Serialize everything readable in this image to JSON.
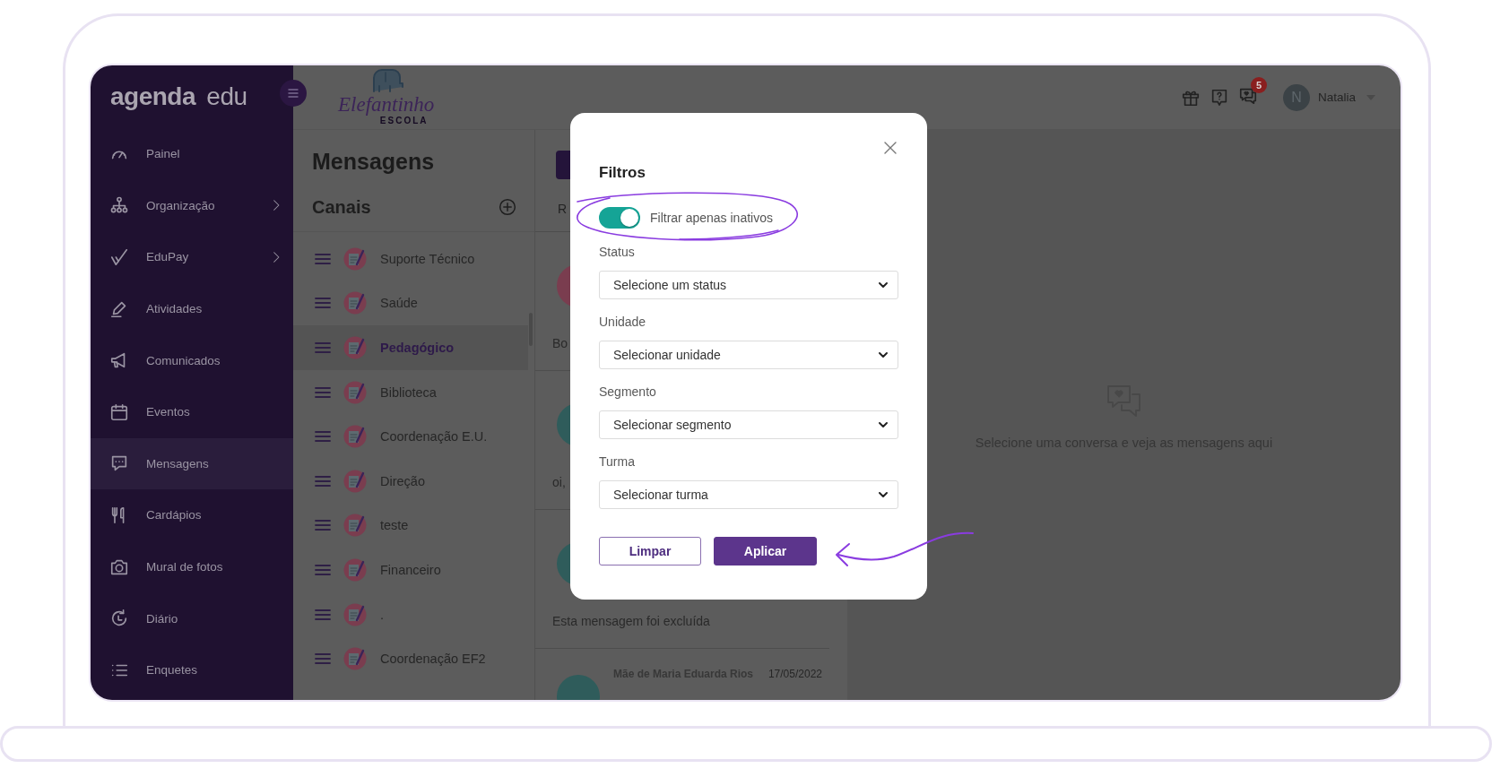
{
  "sidebar": {
    "logo": "**agenda** edu",
    "items": [
      {
        "label": "Painel",
        "selected": false,
        "has_submenu": false
      },
      {
        "label": "Organização",
        "selected": false,
        "has_submenu": true
      },
      {
        "label": "EduPay",
        "selected": false,
        "has_submenu": true
      },
      {
        "label": "Atividades",
        "selected": false,
        "has_submenu": false
      },
      {
        "label": "Comunicados",
        "selected": false,
        "has_submenu": false
      },
      {
        "label": "Eventos",
        "selected": false,
        "has_submenu": false
      },
      {
        "label": "Mensagens",
        "selected": true,
        "has_submenu": false
      },
      {
        "label": "Cardápios",
        "selected": false,
        "has_submenu": false
      },
      {
        "label": "Mural de fotos",
        "selected": false,
        "has_submenu": false
      },
      {
        "label": "Diário",
        "selected": false,
        "has_submenu": false
      },
      {
        "label": "Enquetes",
        "selected": false,
        "has_submenu": false
      }
    ]
  },
  "header": {
    "school_name": "Elefantinho",
    "school_subtitle": "ESCOLA",
    "notification_count": "5",
    "user_initial": "N",
    "user_name": "Natalia"
  },
  "channels_panel": {
    "title": "Mensagens",
    "section_title": "Canais",
    "channels": [
      {
        "name": "Suporte Técnico",
        "selected": false
      },
      {
        "name": "Saúde",
        "selected": false
      },
      {
        "name": "Pedagógico",
        "selected": true
      },
      {
        "name": "Biblioteca",
        "selected": false
      },
      {
        "name": "Coordenação E.U.",
        "selected": false
      },
      {
        "name": "Direção",
        "selected": false
      },
      {
        "name": "teste",
        "selected": false
      },
      {
        "name": "Financeiro",
        "selected": false
      },
      {
        "name": ".",
        "selected": false
      },
      {
        "name": "Coordenação EF2",
        "selected": false
      }
    ]
  },
  "conversations": {
    "tab": "R",
    "items": [
      {
        "kind": "preview",
        "preview": "Bo",
        "color": "#7a3d4f"
      },
      {
        "kind": "preview",
        "preview": "oi,",
        "color": "#2f5c5b"
      },
      {
        "kind": "preview",
        "preview": "Esta mensagem foi excluída",
        "color": "#2f5c5b"
      },
      {
        "kind": "header",
        "sender": "Mãe de Maria Eduarda Rios",
        "date": "17/05/2022",
        "color": "#2f5c5b"
      }
    ]
  },
  "empty_state": {
    "message": "Selecione uma conversa e veja as mensagens aqui"
  },
  "filter_modal": {
    "title": "Filtros",
    "toggle": {
      "label": "Filtrar apenas inativos",
      "on": true
    },
    "filters": [
      {
        "label": "Status",
        "placeholder": "Selecione um status"
      },
      {
        "label": "Unidade",
        "placeholder": "Selecionar unidade"
      },
      {
        "label": "Segmento",
        "placeholder": "Selecionar segmento"
      },
      {
        "label": "Turma",
        "placeholder": "Selecionar turma"
      }
    ],
    "buttons": [
      {
        "label": "Limpar",
        "kind": "secondary"
      },
      {
        "label": "Aplicar",
        "kind": "primary"
      }
    ]
  }
}
